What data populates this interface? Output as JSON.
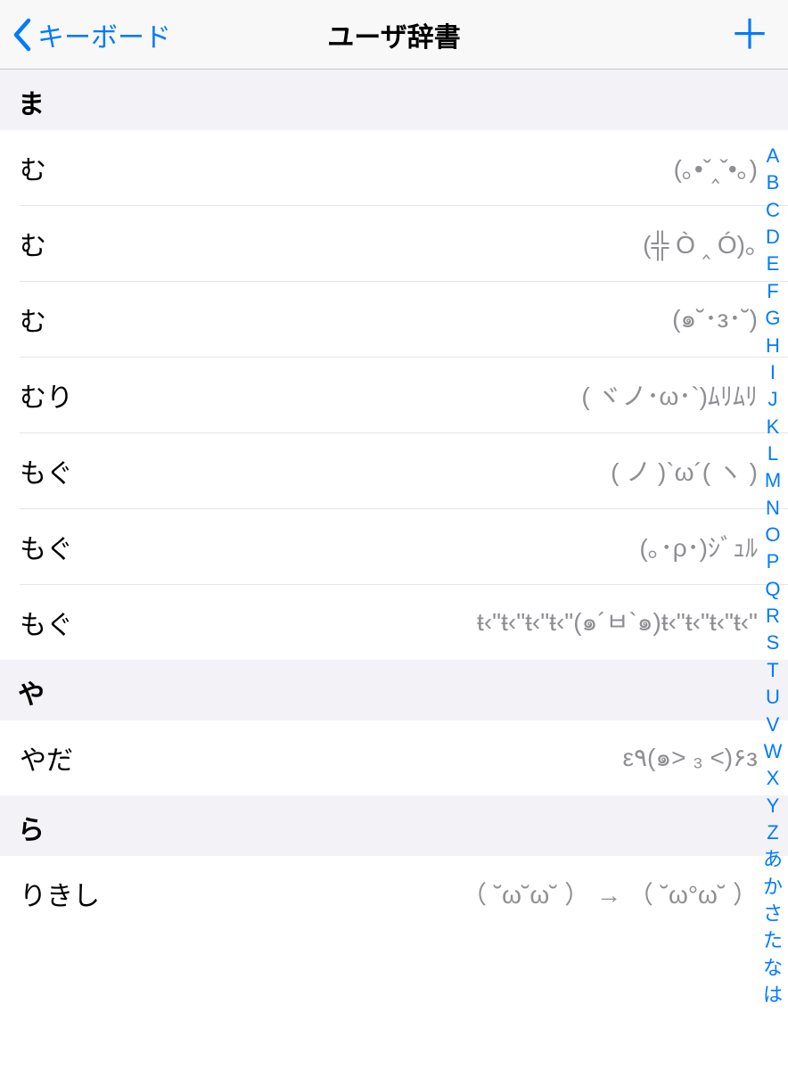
{
  "nav": {
    "back_label": "キーボード",
    "title": "ユーザ辞書",
    "add_label": "＋"
  },
  "sections": [
    {
      "header": "ま",
      "rows": [
        {
          "shortcut": "む",
          "phrase": "(｡•ˇ‸ˇ•｡)"
        },
        {
          "shortcut": "む",
          "phrase": "(╬ Ò ‸ Ó)｡"
        },
        {
          "shortcut": "む",
          "phrase": "(๑˘･з･˘)"
        },
        {
          "shortcut": "むり",
          "phrase": "( ヾノ･ω･`)ﾑﾘﾑﾘ"
        },
        {
          "shortcut": "もぐ",
          "phrase": "( ノ )`ω´( ヽ )"
        },
        {
          "shortcut": "もぐ",
          "phrase": "(｡･ρ･)ｼﾞｭﾙ"
        },
        {
          "shortcut": "もぐ",
          "phrase": "ŧ‹\"ŧ‹\"ŧ‹\"ŧ‹\"(๑´ㅂ`๑)ŧ‹\"ŧ‹\"ŧ‹\"ŧ‹\""
        }
      ]
    },
    {
      "header": "や",
      "rows": [
        {
          "shortcut": "やだ",
          "phrase": "ε٩(๑> ₃ <)۶з"
        }
      ]
    },
    {
      "header": "ら",
      "rows": [
        {
          "shortcut": "りきし",
          "phrase": "（ ˘ω˘ω˘ ） → （ ˘ω°ω˘ ）"
        }
      ]
    }
  ],
  "index": [
    "A",
    "B",
    "C",
    "D",
    "E",
    "F",
    "G",
    "H",
    "I",
    "J",
    "K",
    "L",
    "M",
    "N",
    "O",
    "P",
    "Q",
    "R",
    "S",
    "T",
    "U",
    "V",
    "W",
    "X",
    "Y",
    "Z",
    "あ",
    "か",
    "さ",
    "た",
    "な",
    "は"
  ]
}
